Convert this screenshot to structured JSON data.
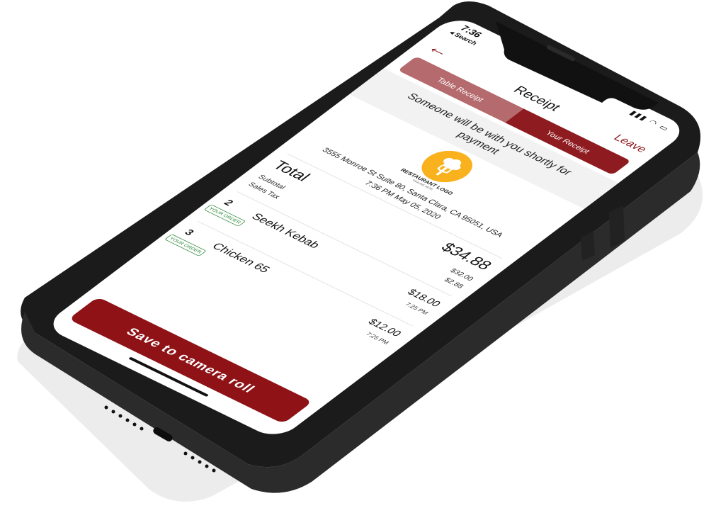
{
  "status": {
    "time": "7:36",
    "back_label": "◂ Search",
    "icons": "▮▮▮ ◠ ▭"
  },
  "nav": {
    "back_icon": "←",
    "title": "Receipt",
    "leave_label": "Leave"
  },
  "tabs": [
    {
      "label": "Table Receipt",
      "active": false
    },
    {
      "label": "Your Receipt",
      "active": true
    }
  ],
  "banner": "Someone will be with you shortly for payment",
  "logo": {
    "icon": "chef-fork-icon",
    "text": "RESTAURANT LOGO",
    "subtext": "TAGLINE HERE"
  },
  "address": "3555 Monroe St Suite 80, Santa Clara, CA 95051, USA",
  "datetime": "7:36 PM May 05, 2020",
  "totals": {
    "total_label": "Total",
    "total_value": "$34.88",
    "subtotal_label": "Subtotal",
    "subtotal_value": "$32.00",
    "tax_label": "Sales Tax",
    "tax_value": "$2.88"
  },
  "items": [
    {
      "qty": "2",
      "name": "Seekh Kebab",
      "price": "$18.00",
      "time": "7:25 PM",
      "badge": "YOUR ORDER"
    },
    {
      "qty": "3",
      "name": "Chicken 65",
      "price": "$12.00",
      "time": "7:25 PM",
      "badge": "YOUR ORDER"
    }
  ],
  "save_button": "Save to camera roll",
  "colors": {
    "brand": "#8e1b1f",
    "button": "#8e1216",
    "tab_inactive": "#b56a6d",
    "badge": "#2e8b3a",
    "logo": "#f9b21d"
  }
}
